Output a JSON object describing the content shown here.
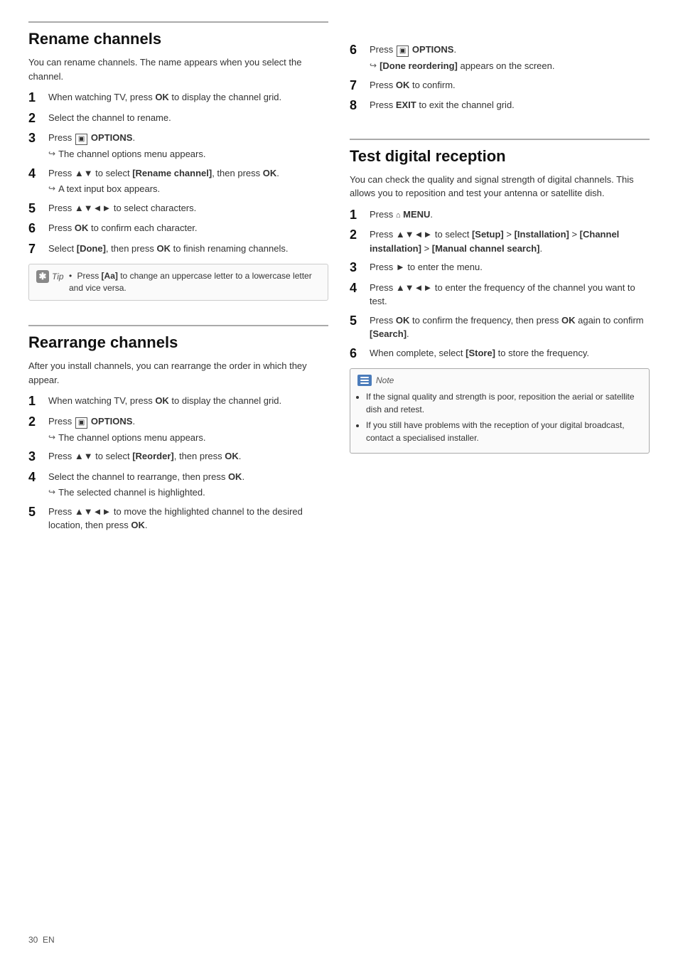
{
  "page": {
    "footer": {
      "page_number": "30",
      "lang": "EN"
    }
  },
  "rename_channels": {
    "title": "Rename channels",
    "intro": "You can rename channels. The name appears when you select the channel.",
    "steps": [
      {
        "num": "1",
        "text": "When watching TV, press <b>OK</b> to display the channel grid."
      },
      {
        "num": "2",
        "text": "Select the channel to rename."
      },
      {
        "num": "3",
        "text": "Press <b>OPTIONS</b>.",
        "sub": "The channel options menu appears."
      },
      {
        "num": "4",
        "text": "Press ▲▼ to select <b>[Rename channel]</b>, then press <b>OK</b>.",
        "sub": "A text input box appears."
      },
      {
        "num": "5",
        "text": "Press ▲▼◄► to select characters."
      },
      {
        "num": "6",
        "text": "Press <b>OK</b> to confirm each character."
      },
      {
        "num": "7",
        "text": "Select <b>[Done]</b>, then press <b>OK</b> to finish renaming channels."
      }
    ],
    "tip": {
      "label": "Tip",
      "content": "Press <b>[Aa]</b> to change an uppercase letter to a lowercase letter and vice versa."
    }
  },
  "rearrange_channels": {
    "title": "Rearrange channels",
    "intro": "After you install channels, you can rearrange the order in which they appear.",
    "steps": [
      {
        "num": "1",
        "text": "When watching TV, press <b>OK</b> to display the channel grid."
      },
      {
        "num": "2",
        "text": "Press <b>OPTIONS</b>.",
        "sub": "The channel options menu appears."
      },
      {
        "num": "3",
        "text": "Press ▲▼ to select <b>[Reorder]</b>, then press <b>OK</b>."
      },
      {
        "num": "4",
        "text": "Select the channel to rearrange, then press <b>OK</b>.",
        "sub": "The selected channel is highlighted."
      },
      {
        "num": "5",
        "text": "Press ▲▼◄► to move the highlighted channel to the desired location, then press <b>OK</b>."
      },
      {
        "num": "6",
        "text": "Press <b>OPTIONS</b>.",
        "sub": "<b>[Done reordering]</b> appears on the screen."
      },
      {
        "num": "7",
        "text": "Press <b>OK</b> to confirm."
      },
      {
        "num": "8",
        "text": "Press <b>EXIT</b> to exit the channel grid."
      }
    ]
  },
  "test_digital_reception": {
    "title": "Test digital reception",
    "intro": "You can check the quality and signal strength of digital channels. This allows you to reposition and test your antenna or satellite dish.",
    "steps": [
      {
        "num": "1",
        "text": "Press <b>MENU</b>."
      },
      {
        "num": "2",
        "text": "Press ▲▼◄► to select <b>[Setup]</b> > <b>[Installation]</b> > <b>[Channel installation]</b> > <b>[Manual channel search]</b>."
      },
      {
        "num": "3",
        "text": "Press ► to enter the menu."
      },
      {
        "num": "4",
        "text": "Press ▲▼◄► to enter the frequency of the channel you want to test."
      },
      {
        "num": "5",
        "text": "Press <b>OK</b> to confirm the frequency, then press <b>OK</b> again to confirm <b>[Search]</b>."
      },
      {
        "num": "6",
        "text": "When complete, select <b>[Store]</b> to store the frequency."
      }
    ],
    "note": {
      "label": "Note",
      "items": [
        "If the signal quality and strength is poor, reposition the aerial or satellite dish and retest.",
        "If you still have problems with the reception of your digital broadcast, contact a specialised installer."
      ]
    }
  }
}
